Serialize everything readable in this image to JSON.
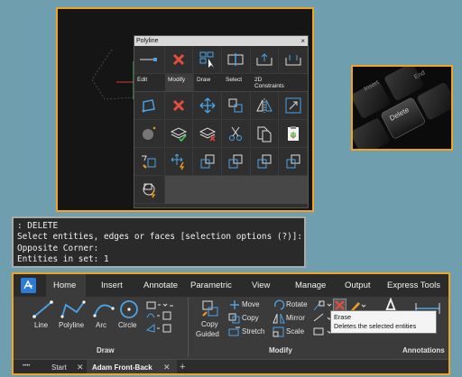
{
  "quad": {
    "title": "Polyline",
    "close": "×",
    "tabs": [
      "Edit",
      "Modify",
      "Draw",
      "Select",
      "2D Constraints"
    ]
  },
  "keyboard": {
    "keys": [
      "Delete",
      "Insert",
      "End"
    ]
  },
  "command": {
    "lines": [
      ": DELETE",
      "Select entities, edges or faces [selection options (?)]:",
      "Opposite Corner:",
      "Entities in set: 1"
    ]
  },
  "ribbon": {
    "tabs": [
      "Home",
      "Insert",
      "Annotate",
      "Parametric",
      "View",
      "Manage",
      "Output",
      "Express Tools"
    ],
    "draw_tools": [
      "Line",
      "Polyline",
      "Arc",
      "Circle"
    ],
    "modify_tools": {
      "copy": "Copy",
      "guided": "Guided",
      "move": "Move",
      "copy_small": "Copy",
      "stretch": "Stretch",
      "rotate": "Rotate",
      "mirror": "Mirror",
      "scale": "Scale"
    },
    "groups": [
      "Draw",
      "Modify",
      "Annotations"
    ],
    "tooltip": {
      "title": "Erase",
      "desc": "Deletes the selected entities"
    },
    "doc_tabs": [
      "Start",
      "Adam Front-Back"
    ],
    "add_tab": "+",
    "more": "••••"
  },
  "colors": {
    "accent_frame": "#f0a31f",
    "background": "#6f9eaf",
    "erase_red": "#e74c3c",
    "icon_blue": "#4aa3e8"
  }
}
